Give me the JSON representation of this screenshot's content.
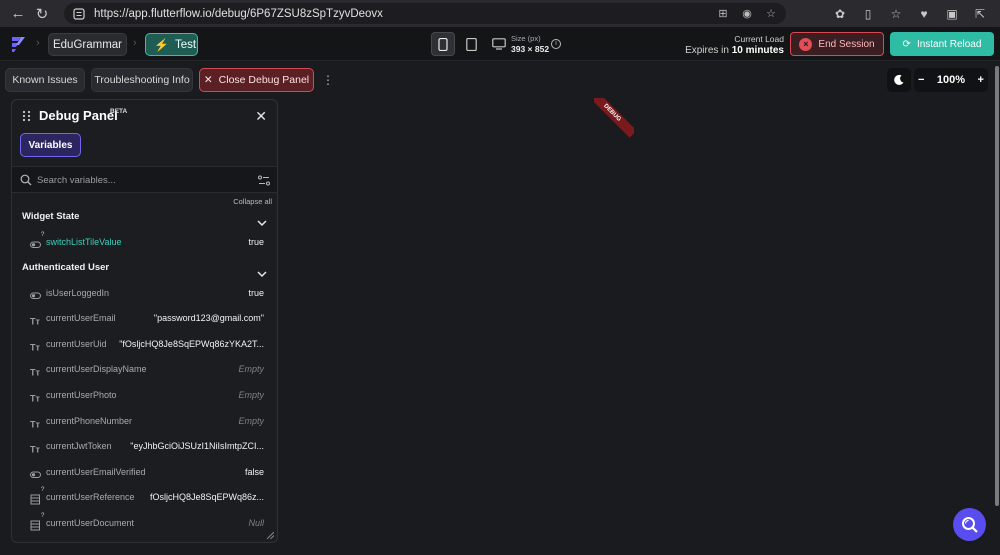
{
  "browser": {
    "url": "https://app.flutterflow.io/debug/6P67ZSU8zSpTzyvDeovx"
  },
  "topbar": {
    "project_name": "EduGrammar",
    "mode_label": "Test",
    "size_label": "Size (px)",
    "size_value": "393 × 852",
    "current_load_label": "Current Load",
    "expires_prefix": "Expires in",
    "expires_value": "10 minutes",
    "end_session_label": "End Session",
    "instant_reload_label": "Instant Reload"
  },
  "toolbar": {
    "known_issues_label": "Known Issues",
    "troubleshooting_label": "Troubleshooting Info",
    "close_debug_label": "Close Debug Panel",
    "zoom_value": "100%"
  },
  "debug_panel": {
    "title": "Debug Panel",
    "beta_badge": "BETA",
    "tab_variables": "Variables",
    "search_placeholder": "Search variables...",
    "collapse_all_label": "Collapse all",
    "sections": [
      {
        "title": "Widget State",
        "rows": [
          {
            "name": "switchListTileValue",
            "value": "true",
            "icon": "toggle-icon",
            "highlight": true,
            "has_query": true
          }
        ]
      },
      {
        "title": "Authenticated User",
        "rows": [
          {
            "name": "isUserLoggedIn",
            "value": "true",
            "icon": "toggle-icon"
          },
          {
            "name": "currentUserEmail",
            "value": "\"password123@gmail.com\"",
            "icon": "text-type-icon"
          },
          {
            "name": "currentUserUid",
            "value": "\"fOsljcHQ8Je8SqEPWq86zYKA2T...",
            "icon": "text-type-icon"
          },
          {
            "name": "currentUserDisplayName",
            "value": "Empty",
            "icon": "text-type-icon",
            "empty": true
          },
          {
            "name": "currentUserPhoto",
            "value": "Empty",
            "icon": "text-type-icon",
            "empty": true
          },
          {
            "name": "currentPhoneNumber",
            "value": "Empty",
            "icon": "text-type-icon",
            "empty": true
          },
          {
            "name": "currentJwtToken",
            "value": "\"eyJhbGciOiJSUzI1NiIsImtpZCI...",
            "icon": "text-type-icon"
          },
          {
            "name": "currentUserEmailVerified",
            "value": "false",
            "icon": "toggle-icon"
          },
          {
            "name": "currentUserReference",
            "value": "fOsljcHQ8Je8SqEPWq86z...",
            "icon": "document-icon",
            "has_query": true
          },
          {
            "name": "currentUserDocument",
            "value": "Null",
            "icon": "document-icon",
            "empty": true,
            "has_query": true
          }
        ]
      }
    ]
  },
  "canvas": {
    "debug_ribbon": "DEBUG"
  },
  "colors": {
    "accent_teal": "#2fbca5",
    "danger_red": "#d84a52",
    "purple": "#7167ef"
  }
}
